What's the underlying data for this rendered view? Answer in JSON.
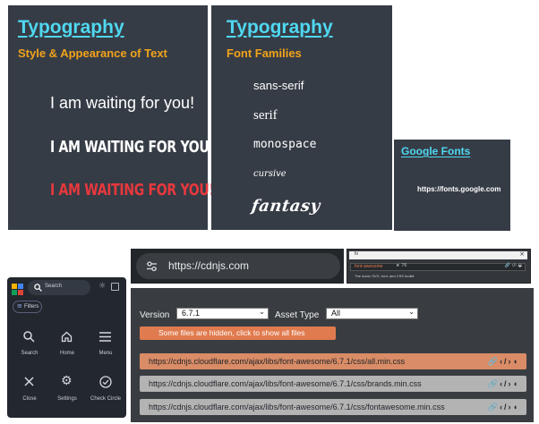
{
  "slide1": {
    "title": "Typography",
    "subtitle": "Style & Appearance of Text",
    "line1": "I am waiting for you!",
    "line2": "I AM WAITING FOR YOU!",
    "line3": "I AM WAITING FOR YOU!"
  },
  "slide2": {
    "title": "Typography",
    "subtitle": "Font Families",
    "families": [
      "sans-serif",
      "serif",
      "monospace",
      "cursive",
      "fantasy"
    ]
  },
  "slide3": {
    "title": "Google Fonts",
    "url": "https://fonts.google.com"
  },
  "mobile": {
    "search_placeholder": "Search",
    "filters_label": "Filters",
    "icons": [
      {
        "label": "Search",
        "icon": "search-icon"
      },
      {
        "label": "Home",
        "icon": "home-icon"
      },
      {
        "label": "Menu",
        "icon": "menu-icon"
      },
      {
        "label": "Close",
        "icon": "close-icon"
      },
      {
        "label": "Settings",
        "icon": "gear-icon"
      },
      {
        "label": "Check Circle",
        "icon": "check-circle-icon"
      }
    ]
  },
  "browser": {
    "address": "https://cdnjs.com"
  },
  "mini": {
    "search_value": "fo",
    "result_title": "font-awesome",
    "result_desc": "The iconic SVG, font, and CSS toolkit"
  },
  "cdn": {
    "version_label": "Version",
    "version_value": "6.7.1",
    "asset_label": "Asset Type",
    "asset_value": "All",
    "hidden_notice": "Some files are hidden, click to show all files",
    "files": [
      "https://cdnjs.cloudflare.com/ajax/libs/font-awesome/6.7.1/css/all.min.css",
      "https://cdnjs.cloudflare.com/ajax/libs/font-awesome/6.7.1/css/brands.min.css",
      "https://cdnjs.cloudflare.com/ajax/libs/font-awesome/6.7.1/css/fontawesome.min.css"
    ]
  },
  "colors": {
    "slide_bg": "#363c46",
    "title_cyan": "#4fd8f0",
    "subtitle_orange": "#f2a31a",
    "red_text": "#e8383d",
    "cdn_orange": "#e07b4f",
    "cdn_row_highlight": "#d98c66",
    "cdn_row_grey": "#b3b3b3"
  }
}
